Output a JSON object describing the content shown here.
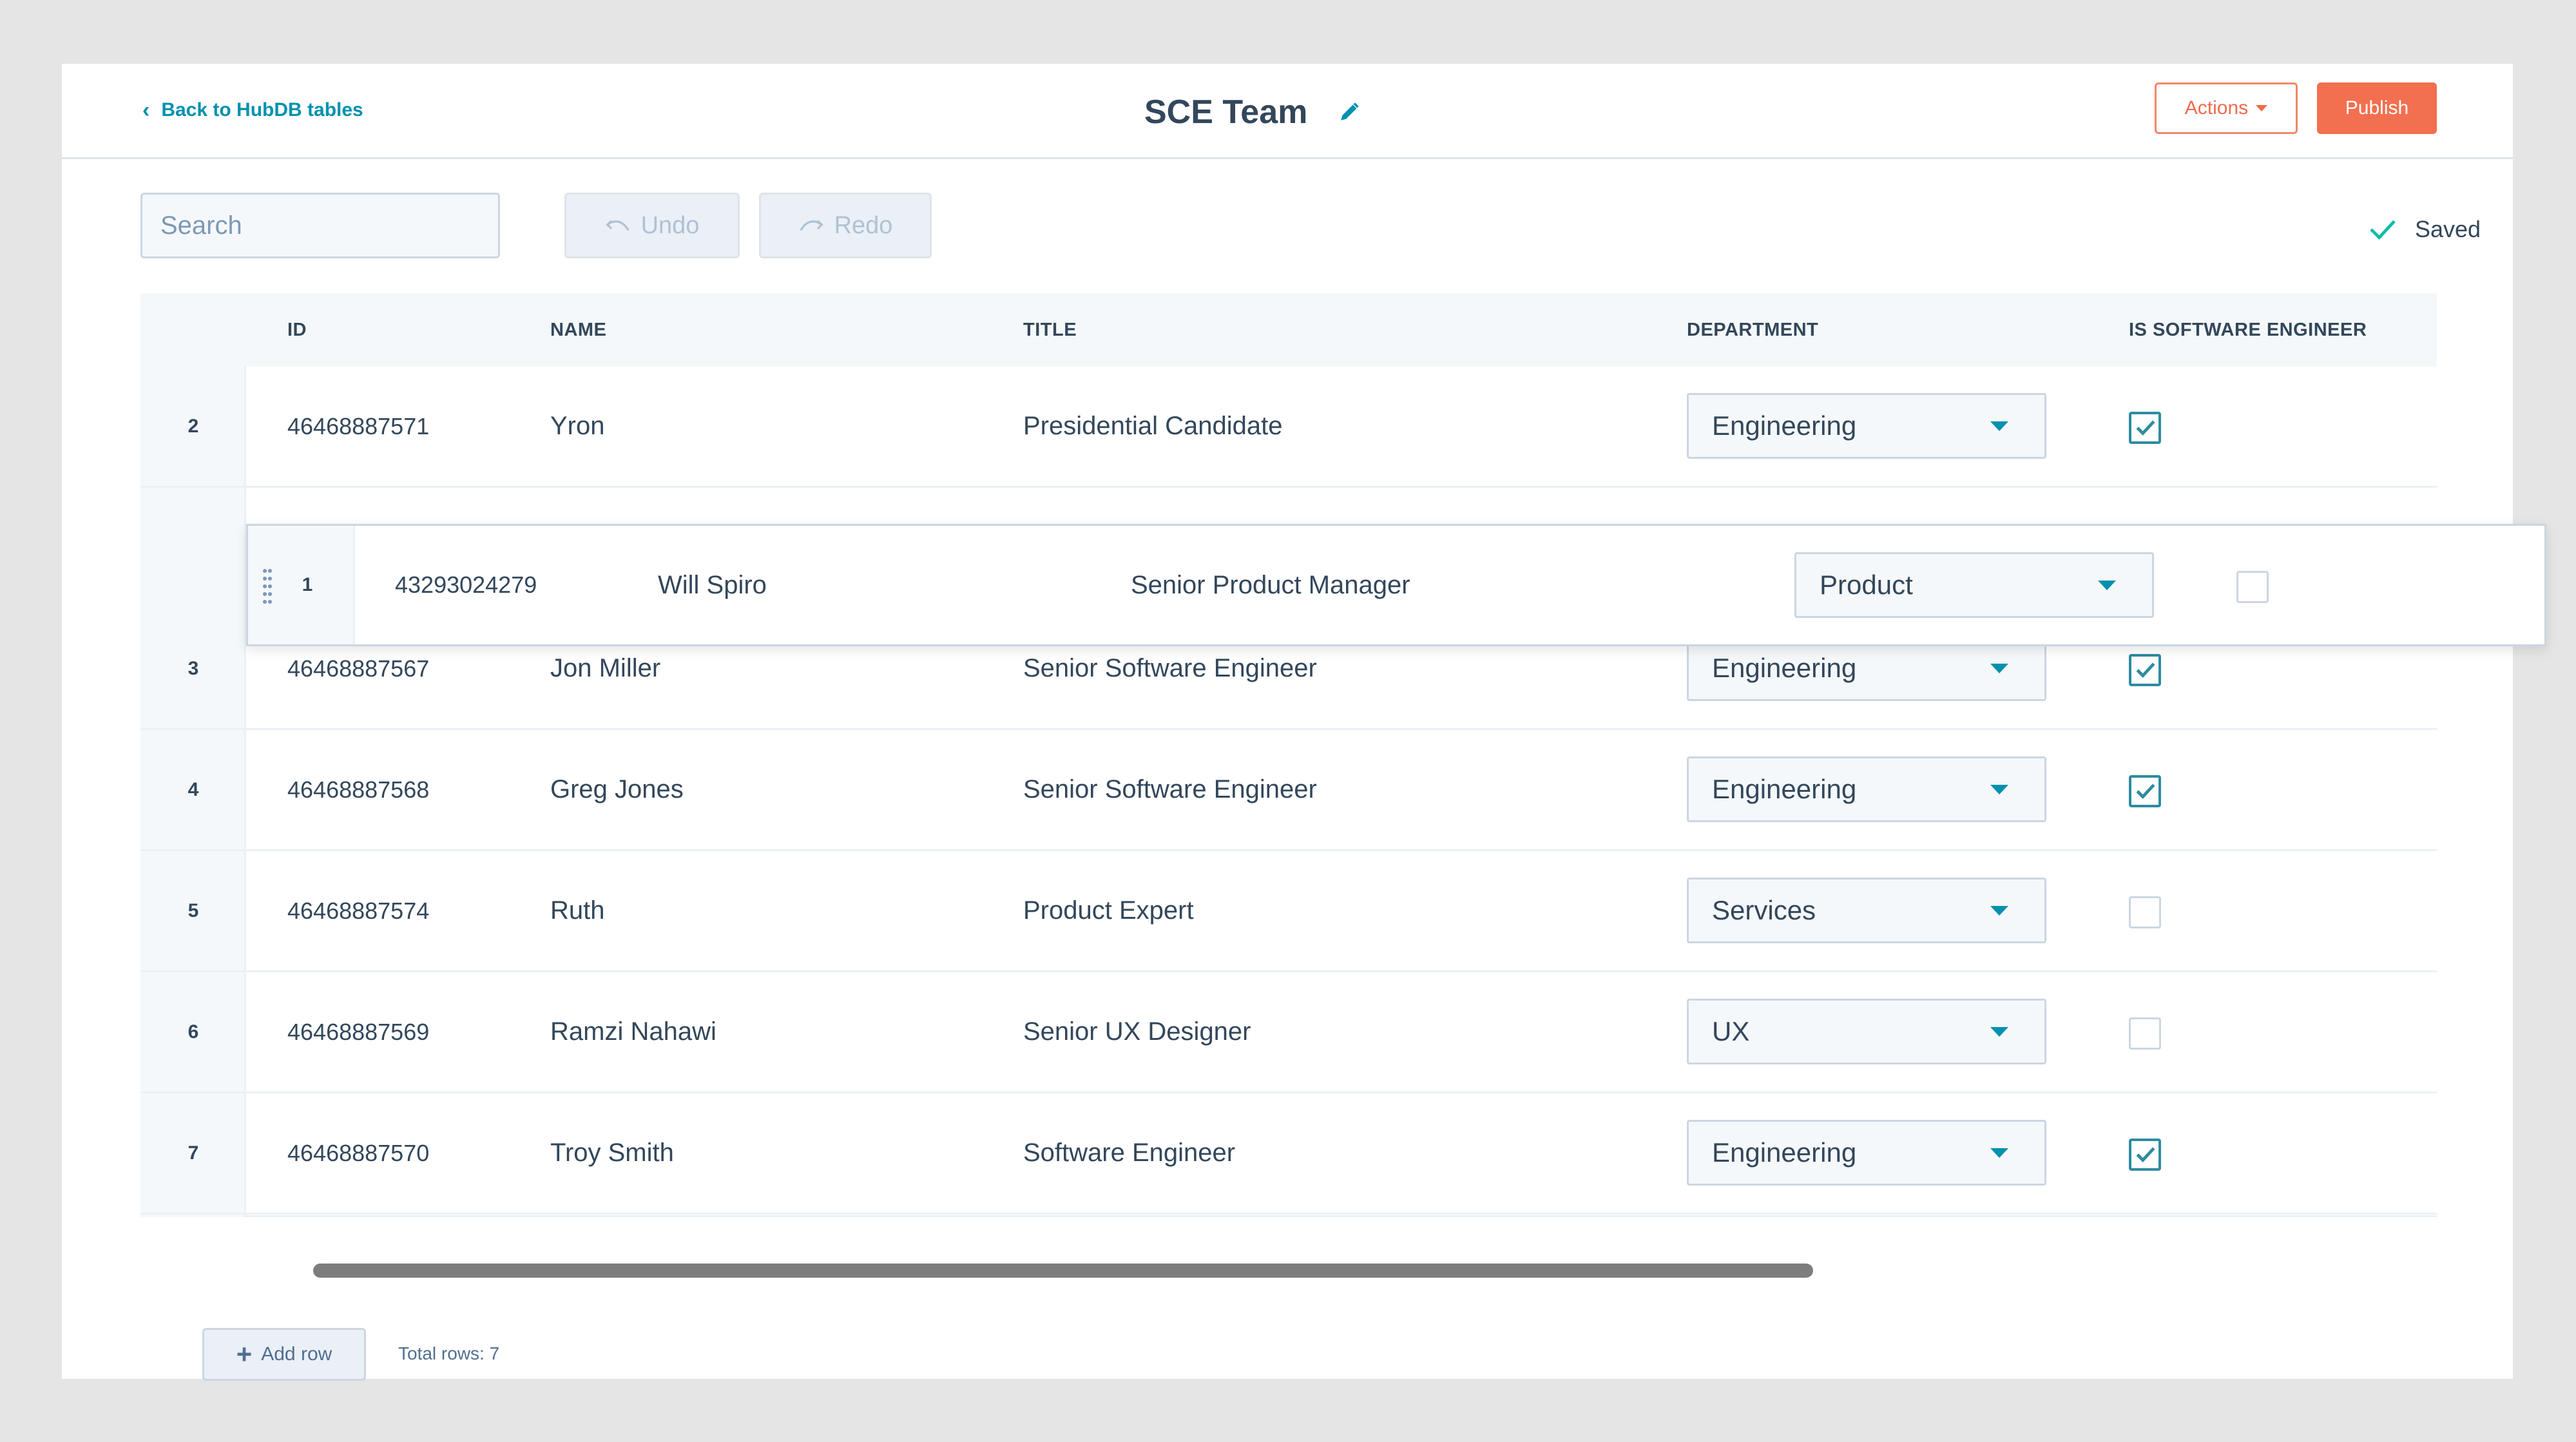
{
  "header": {
    "back_label": "Back to HubDB tables",
    "title": "SCE Team",
    "actions_label": "Actions",
    "publish_label": "Publish"
  },
  "toolbar": {
    "search_placeholder": "Search",
    "undo_label": "Undo",
    "redo_label": "Redo",
    "saved_label": "Saved"
  },
  "table": {
    "columns": [
      "ID",
      "NAME",
      "TITLE",
      "DEPARTMENT",
      "IS SOFTWARE ENGINEER"
    ],
    "rows": [
      {
        "num": "2",
        "id": "46468887571",
        "name": "Yron",
        "title": "Presidential Candidate",
        "department": "Engineering",
        "is_software_engineer": true
      },
      {
        "num": "3",
        "id": "46468887567",
        "name": "Jon Miller",
        "title": "Senior Software Engineer",
        "department": "Engineering",
        "is_software_engineer": true
      },
      {
        "num": "4",
        "id": "46468887568",
        "name": "Greg Jones",
        "title": "Senior Software Engineer",
        "department": "Engineering",
        "is_software_engineer": true
      },
      {
        "num": "5",
        "id": "46468887574",
        "name": "Ruth",
        "title": "Product Expert",
        "department": "Services",
        "is_software_engineer": false
      },
      {
        "num": "6",
        "id": "46468887569",
        "name": "Ramzi Nahawi",
        "title": "Senior UX Designer",
        "department": "UX",
        "is_software_engineer": false
      },
      {
        "num": "7",
        "id": "46468887570",
        "name": "Troy Smith",
        "title": "Software Engineer",
        "department": "Engineering",
        "is_software_engineer": true
      }
    ],
    "dragged_row": {
      "num": "1",
      "id": "43293024279",
      "name": "Will Spiro",
      "title": "Senior Product Manager",
      "department": "Product",
      "is_software_engineer": false
    }
  },
  "footer": {
    "add_row_label": "Add row",
    "total_rows_label": "Total rows: 7"
  },
  "colors": {
    "accent": "#0091ae",
    "publish": "#f2704f",
    "checkbox": "#2d8ca0"
  },
  "icons": {
    "back": "chevron-left-icon",
    "edit": "pencil-icon",
    "search": "search-icon",
    "undo": "undo-icon",
    "redo": "redo-icon",
    "saved": "checkmark-icon",
    "drag": "drag-handle-icon",
    "dropdown": "caret-down-icon",
    "add": "plus-icon"
  }
}
